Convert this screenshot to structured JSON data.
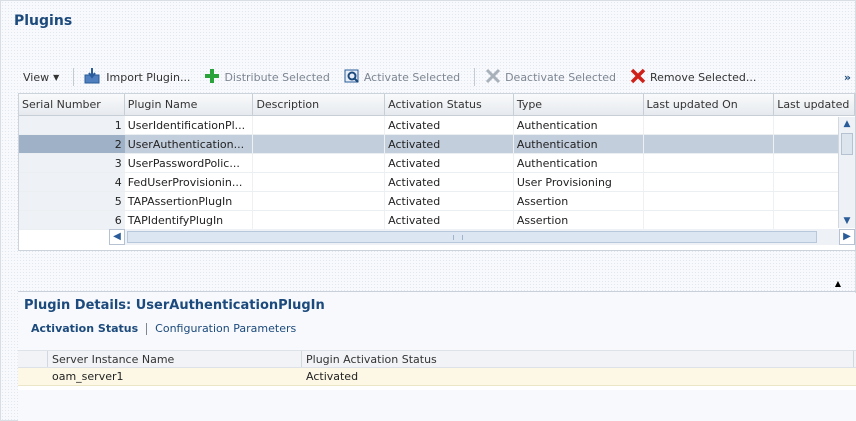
{
  "page": {
    "title": "Plugins"
  },
  "toolbar": {
    "view_label": "View",
    "import_label": "Import Plugin...",
    "distribute_label": "Distribute Selected",
    "activate_label": "Activate Selected",
    "deactivate_label": "Deactivate Selected",
    "remove_label": "Remove Selected...",
    "more_label": "»"
  },
  "table": {
    "columns": [
      "Serial Number",
      "Plugin Name",
      "Description",
      "Activation Status",
      "Type",
      "Last updated On",
      "Last updated"
    ],
    "rows": [
      {
        "num": "1",
        "name": "UserIdentificationPl...",
        "description": "",
        "status": "Activated",
        "type": "Authentication",
        "updated_on": "",
        "updated": ""
      },
      {
        "num": "2",
        "name": "UserAuthentication...",
        "description": "",
        "status": "Activated",
        "type": "Authentication",
        "updated_on": "",
        "updated": ""
      },
      {
        "num": "3",
        "name": "UserPasswordPolic...",
        "description": "",
        "status": "Activated",
        "type": "Authentication",
        "updated_on": "",
        "updated": ""
      },
      {
        "num": "4",
        "name": "FedUserProvisionin...",
        "description": "",
        "status": "Activated",
        "type": "User Provisioning",
        "updated_on": "",
        "updated": ""
      },
      {
        "num": "5",
        "name": "TAPAssertionPlugIn",
        "description": "",
        "status": "Activated",
        "type": "Assertion",
        "updated_on": "",
        "updated": ""
      },
      {
        "num": "6",
        "name": "TAPIdentifyPlugIn",
        "description": "",
        "status": "Activated",
        "type": "Assertion",
        "updated_on": "",
        "updated": ""
      }
    ],
    "selected_row": 2
  },
  "details": {
    "title": "Plugin Details: UserAuthenticationPlugIn",
    "tabs": {
      "active": "Activation Status",
      "other": "Configuration Parameters"
    },
    "columns": [
      "Server Instance Name",
      "Plugin Activation Status"
    ],
    "rows": [
      {
        "server": "oam_server1",
        "status": "Activated"
      }
    ]
  },
  "colors": {
    "title": "#1c4a7c",
    "selected_row": "#c3cedd",
    "details_row": "#fcf8e5",
    "add_icon": "#2aa33a",
    "remove_icon": "#d0201a"
  },
  "icons": [
    "view-caret-icon",
    "import-icon",
    "distribute-icon",
    "activate-icon",
    "deactivate-icon",
    "remove-icon",
    "more-icon"
  ]
}
